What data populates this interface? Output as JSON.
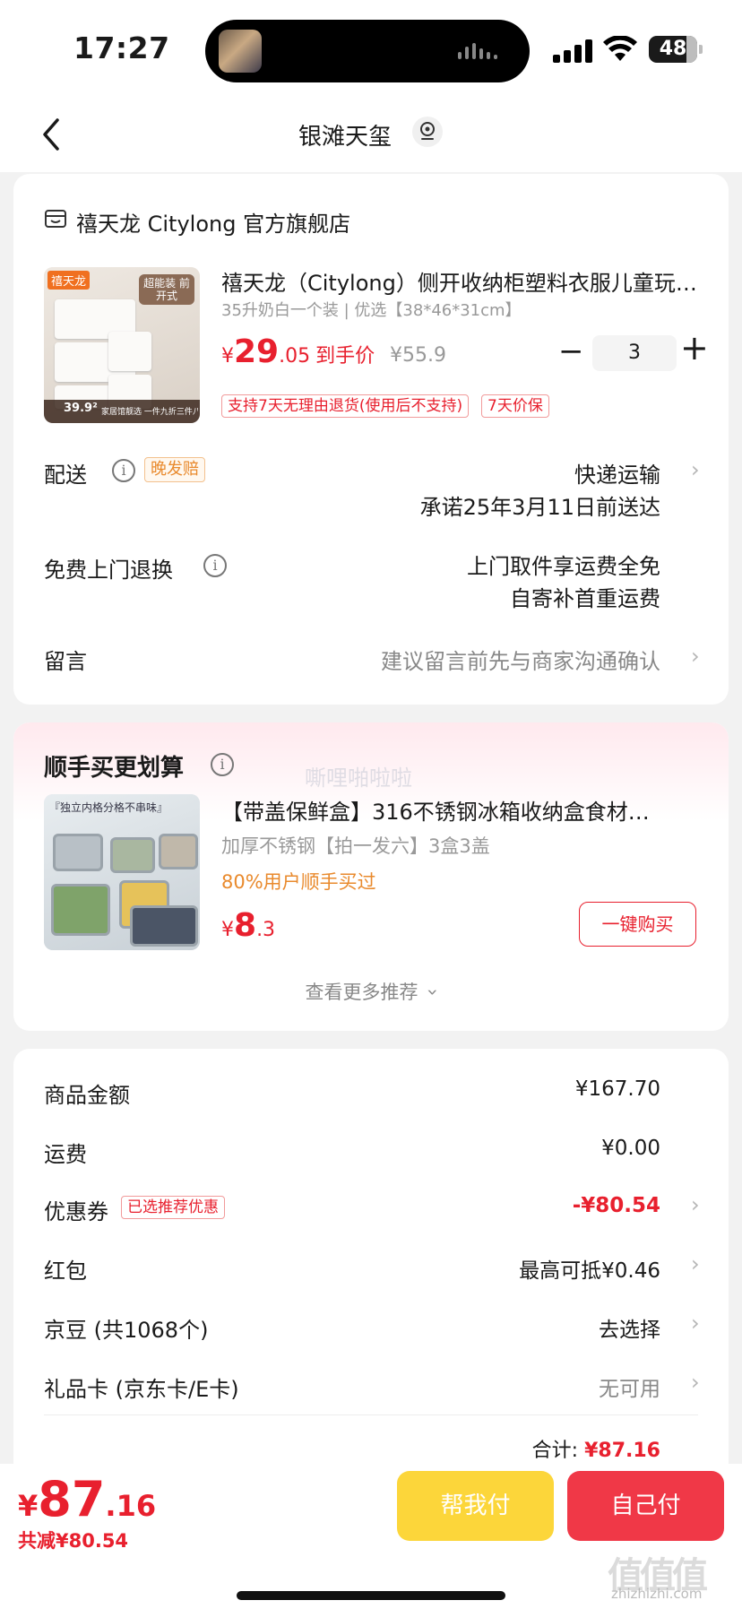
{
  "status_bar": {
    "time": "17:27",
    "battery": "48"
  },
  "nav": {
    "title": "银滩天玺"
  },
  "order": {
    "store_name": "禧天龙 Citylong 官方旗舰店",
    "product": {
      "title": "禧天龙（Citylong）侧开收纳柜塑料衣服儿童玩…",
      "spec": "35升奶白一个装 | 优选【38*46*31cm】",
      "price_yen": "¥",
      "price_int": "29",
      "price_dec": ".05",
      "price_suffix": "到手价",
      "original_price": "¥55.9",
      "quantity": "3",
      "tags": [
        "支持7天无理由退货(使用后不支持)",
        "7天价保"
      ],
      "image_texts": {
        "brand": "禧天龙",
        "feature": "超能装 前开式",
        "price": "39.9²",
        "slogan": "家居馆靓选 一件九折三件八折"
      }
    },
    "delivery": {
      "label": "配送",
      "badge": "晚发赔",
      "method": "快递运输",
      "promise": "承诺25年3月11日前送达"
    },
    "return": {
      "label": "免费上门退换",
      "line1": "上门取件享运费全免",
      "line2": "自寄补首重运费"
    },
    "message": {
      "label": "留言",
      "placeholder": "建议留言前先与商家沟通确认"
    }
  },
  "recommend": {
    "title": "顺手买更划算",
    "watermark": "嘶哩啪啦啦",
    "item": {
      "name": "【带盖保鲜盒】316不锈钢冰箱收纳盒食材…",
      "spec": "加厚不锈钢【拍一发六】3盒3盖",
      "tip": "80%用户顺手买过",
      "price_yen": "¥",
      "price_int": "8",
      "price_dec": ".3",
      "buy_label": "一键购买",
      "image_text": "『独立内格分格不串味』"
    },
    "see_more": "查看更多推荐"
  },
  "summary": {
    "goods_label": "商品金额",
    "goods_value": "¥167.70",
    "freight_label": "运费",
    "freight_value": "¥0.00",
    "coupon_label": "优惠券",
    "coupon_badge": "已选推荐优惠",
    "coupon_value": "-¥80.54",
    "redpacket_label": "红包",
    "redpacket_value": "最高可抵¥0.46",
    "jingdou_label": "京豆 (共1068个)",
    "jingdou_value": "去选择",
    "giftcard_label": "礼品卡 (京东卡/E卡)",
    "giftcard_value": "无可用",
    "total_label": "合计:",
    "total_value": "¥87.16"
  },
  "bottom": {
    "pay_yen": "¥",
    "pay_int": "87",
    "pay_dec": ".16",
    "discount": "共减¥80.54",
    "help_pay": "帮我付",
    "self_pay": "自己付"
  },
  "watermark_site": {
    "logo": "值值值",
    "url": "zhizhizhi.com"
  },
  "colors": {
    "accent_red": "#e8202e",
    "help_button": "#fcd63a",
    "self_button": "#f03847",
    "tip_orange": "#e98a2d"
  },
  "icons": [
    "signal-icon",
    "wifi-icon",
    "battery-icon",
    "back-icon",
    "location-icon",
    "store-icon",
    "info-icon",
    "chevron-right-icon",
    "chevron-down-icon"
  ]
}
